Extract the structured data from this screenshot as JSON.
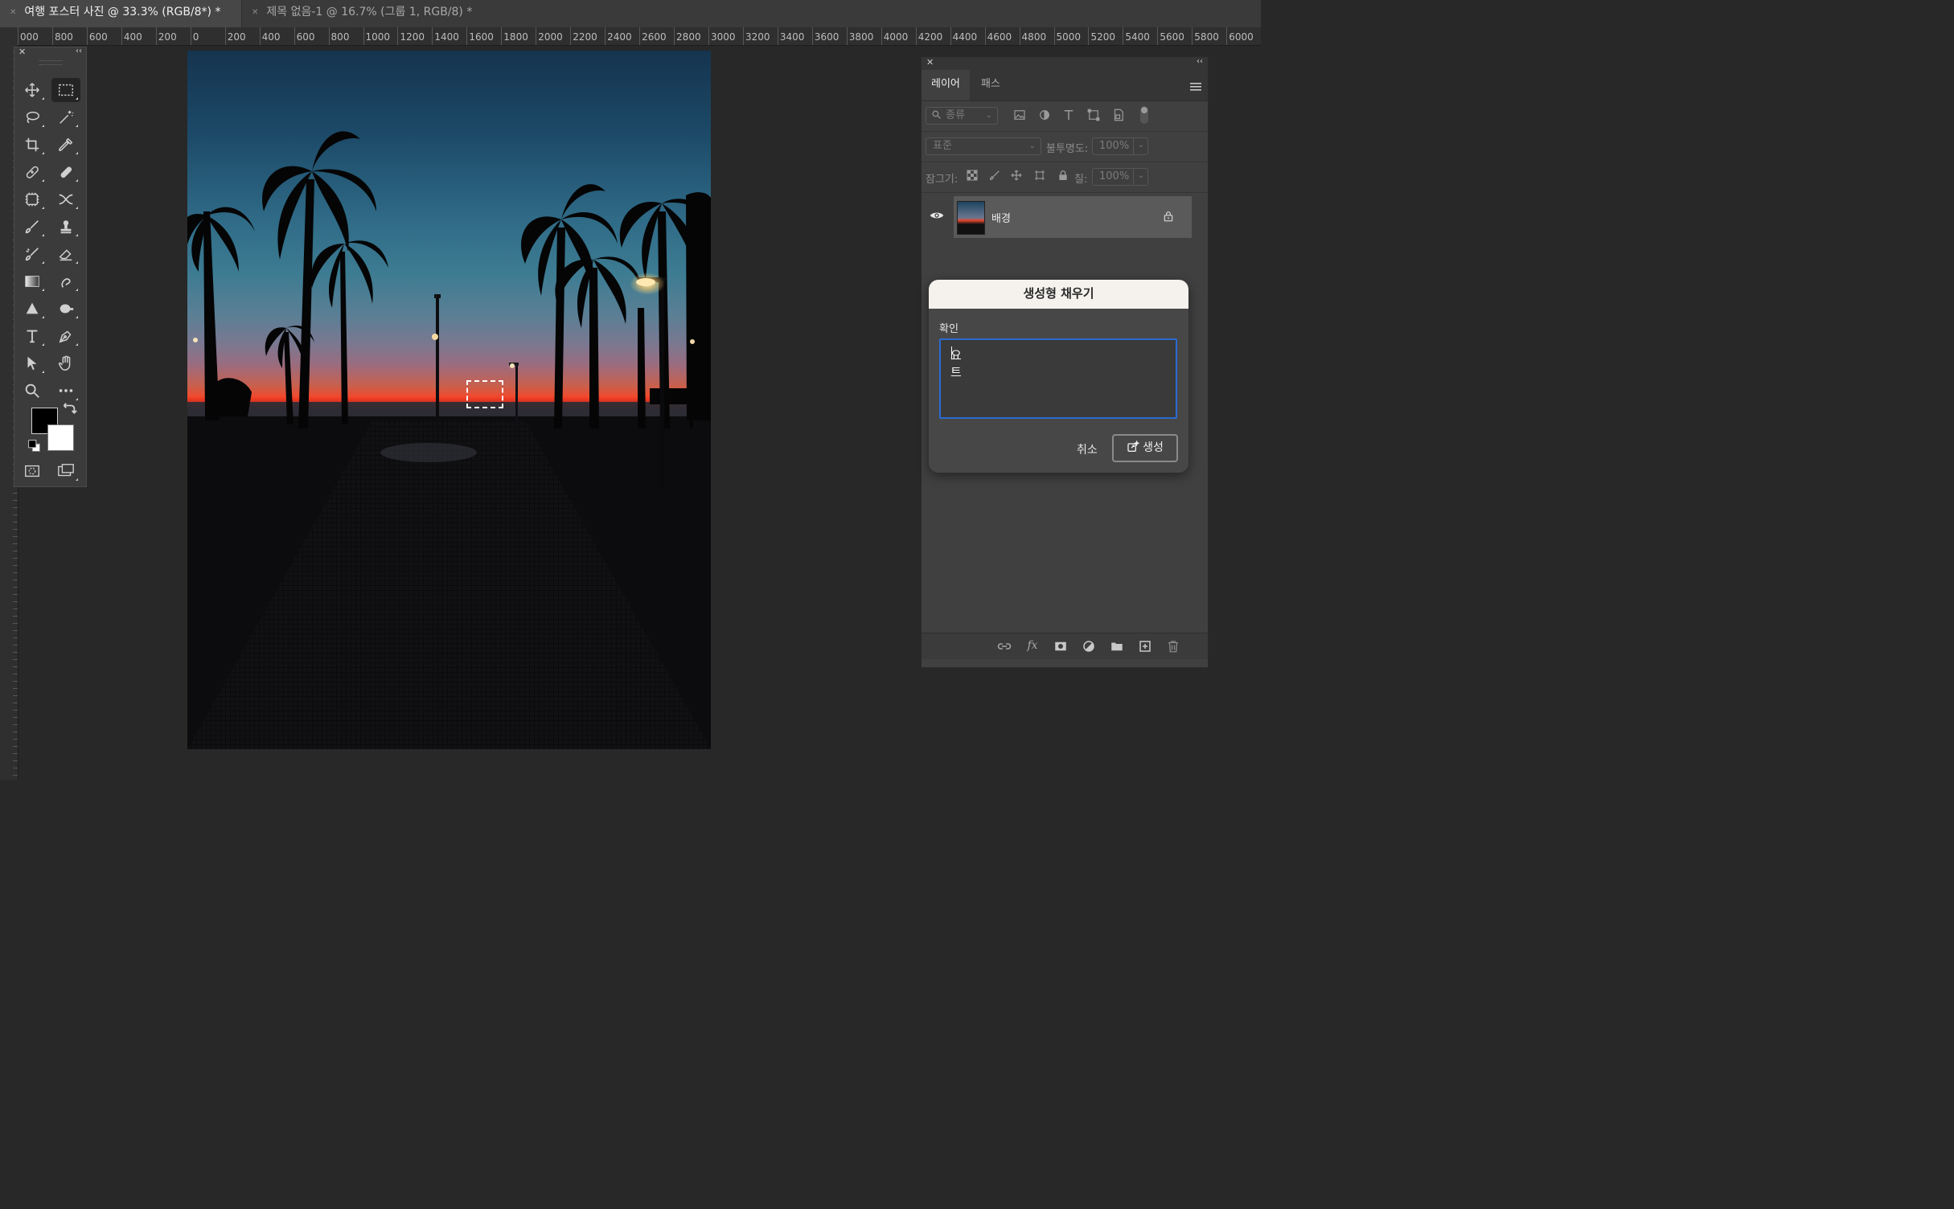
{
  "tabs": [
    {
      "label": "여행 포스터 사진 @ 33.3% (RGB/8*) *",
      "active": true
    },
    {
      "label": "제목 없음-1 @ 16.7% (그룹 1, RGB/8) *",
      "active": false
    }
  ],
  "ruler": {
    "h_labels": [
      "000",
      "800",
      "600",
      "400",
      "200",
      "0",
      "200",
      "400",
      "600",
      "800",
      "1000",
      "1200",
      "1400",
      "1600",
      "1800",
      "2000",
      "2200",
      "2400",
      "2600",
      "2800",
      "3000",
      "3200",
      "3400",
      "3600",
      "3800",
      "4000",
      "4200",
      "4400",
      "4600",
      "4800",
      "5000",
      "5200",
      "5400",
      "5600",
      "5800",
      "6000"
    ]
  },
  "toolbar": {
    "close": "✕",
    "collapse": "‹‹",
    "tools": [
      "move-tool",
      "rectangular-marquee-tool",
      "lasso-tool",
      "magic-wand-tool",
      "crop-tool",
      "eyedropper-tool",
      "spot-healing-brush-tool",
      "healing-brush-tool",
      "content-aware-tool",
      "remix-tool",
      "brush-tool",
      "clone-stamp-tool",
      "history-brush-tool",
      "eraser-tool",
      "gradient-tool",
      "smudge-tool",
      "sharpen-tool",
      "dodge-tool",
      "type-tool",
      "pen-tool",
      "path-selection-tool",
      "hand-tool",
      "zoom-tool",
      "more-tools",
      "quick-mask",
      "screen-mode"
    ],
    "foreground_color": "#000000",
    "background_color": "#ffffff"
  },
  "layers_panel": {
    "close": "✕",
    "collapse": "‹‹",
    "tab_layers": "레이어",
    "tab_paths": "패스",
    "filter_placeholder": "종류",
    "blend_mode": "표준",
    "opacity_label": "불투명도:",
    "opacity_value": "100%",
    "lock_label": "잠그기:",
    "fill_label": "칠:",
    "fill_value": "100%",
    "layer_name": "배경"
  },
  "dialog": {
    "title": "생성형 채우기",
    "prompt_label": "확인",
    "prompt_value": "요트",
    "cancel_label": "취소",
    "generate_label": "생성"
  },
  "colors": {
    "accent": "#2a6bd1",
    "panel_bg": "#404040",
    "app_bg": "#282828"
  }
}
